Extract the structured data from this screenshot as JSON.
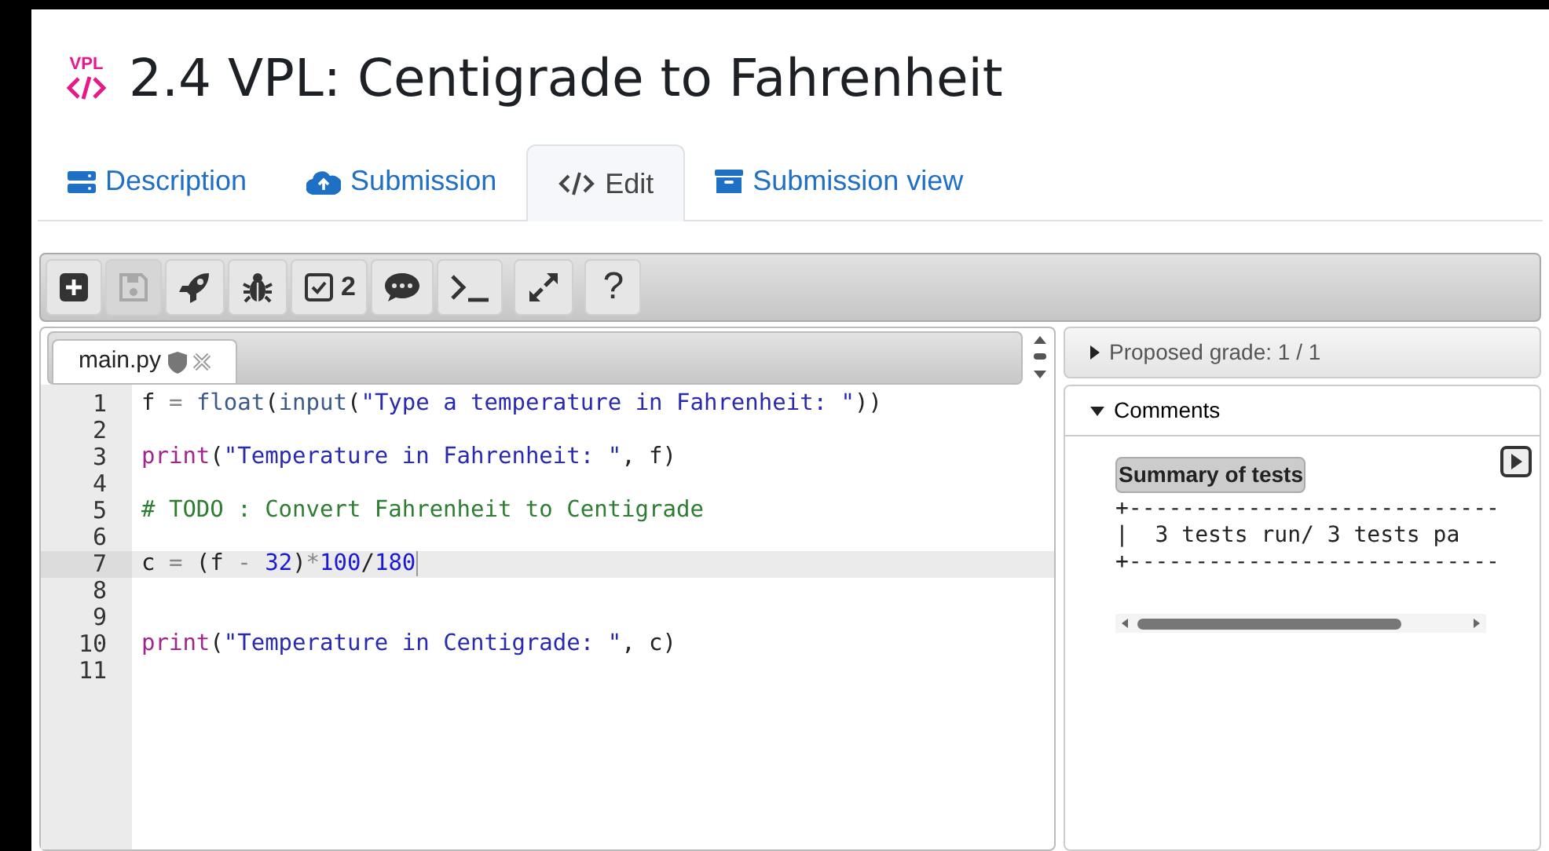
{
  "page": {
    "logo_text": "VPL",
    "title": "2.4 VPL: Centigrade to Fahrenheit"
  },
  "tabs": [
    {
      "label": "Description",
      "selected": false
    },
    {
      "label": "Submission",
      "selected": false
    },
    {
      "label": "Edit",
      "selected": true
    },
    {
      "label": "Submission view",
      "selected": false
    }
  ],
  "toolbar": [
    {
      "kind": "new",
      "disabled": false
    },
    {
      "kind": "save",
      "disabled": true
    },
    {
      "kind": "run",
      "disabled": false
    },
    {
      "kind": "debug",
      "disabled": false
    },
    {
      "kind": "evaluate",
      "label": "2",
      "disabled": false
    },
    {
      "kind": "comments",
      "disabled": false
    },
    {
      "kind": "console",
      "disabled": false
    },
    {
      "kind": "fullscreen",
      "disabled": false
    },
    {
      "kind": "help",
      "label": "?",
      "disabled": false
    }
  ],
  "file_tabs": [
    {
      "label": "main.py",
      "selected": true
    }
  ],
  "code_lines": [
    {
      "number": "1",
      "current": false,
      "tokens": [
        {
          "text": "f ",
          "kind": "plain"
        },
        {
          "text": "= ",
          "kind": "op"
        },
        {
          "text": "float",
          "kind": "builtin"
        },
        {
          "text": "(",
          "kind": "plain"
        },
        {
          "text": "input",
          "kind": "builtin"
        },
        {
          "text": "(",
          "kind": "plain"
        },
        {
          "text": "\"Type a temperature in Fahrenheit: \"",
          "kind": "string"
        },
        {
          "text": "))",
          "kind": "plain"
        }
      ]
    },
    {
      "number": "2",
      "current": false
    },
    {
      "number": "3",
      "current": false,
      "tokens": [
        {
          "text": "print",
          "kind": "keyword"
        },
        {
          "text": "(",
          "kind": "plain"
        },
        {
          "text": "\"Temperature in Fahrenheit: \"",
          "kind": "string"
        },
        {
          "text": ", f)",
          "kind": "plain"
        }
      ]
    },
    {
      "number": "4",
      "current": false
    },
    {
      "number": "5",
      "current": false,
      "tokens": [
        {
          "text": "# TODO : Convert Fahrenheit to Centigrade",
          "kind": "comment"
        }
      ]
    },
    {
      "number": "6",
      "current": false
    },
    {
      "number": "7",
      "current": true,
      "tokens": [
        {
          "text": "c ",
          "kind": "plain"
        },
        {
          "text": "=",
          "kind": "op"
        },
        {
          "text": " (f ",
          "kind": "plain"
        },
        {
          "text": "- ",
          "kind": "op"
        },
        {
          "text": "32",
          "kind": "number"
        },
        {
          "text": ")",
          "kind": "plain"
        },
        {
          "text": "*",
          "kind": "op"
        },
        {
          "text": "100",
          "kind": "number"
        },
        {
          "text": "/",
          "kind": "plain"
        },
        {
          "text": "180",
          "kind": "number"
        }
      ]
    },
    {
      "number": "8",
      "current": false
    },
    {
      "number": "9",
      "current": false
    },
    {
      "number": "10",
      "current": false,
      "tokens": [
        {
          "text": "print",
          "kind": "keyword"
        },
        {
          "text": "(",
          "kind": "plain"
        },
        {
          "text": "\"Temperature in Centigrade: \"",
          "kind": "string"
        },
        {
          "text": ", c)",
          "kind": "plain"
        }
      ]
    },
    {
      "number": "11",
      "current": false
    }
  ],
  "results": [
    {
      "label": "Proposed grade: 1 / 1",
      "expanded": false
    },
    {
      "label": "Comments",
      "expanded": true
    }
  ],
  "comments": {
    "heading": "Summary of tests",
    "lines": [
      "+----------------------------",
      "|  3 tests run/ 3 tests pa",
      "+----------------------------"
    ]
  }
}
